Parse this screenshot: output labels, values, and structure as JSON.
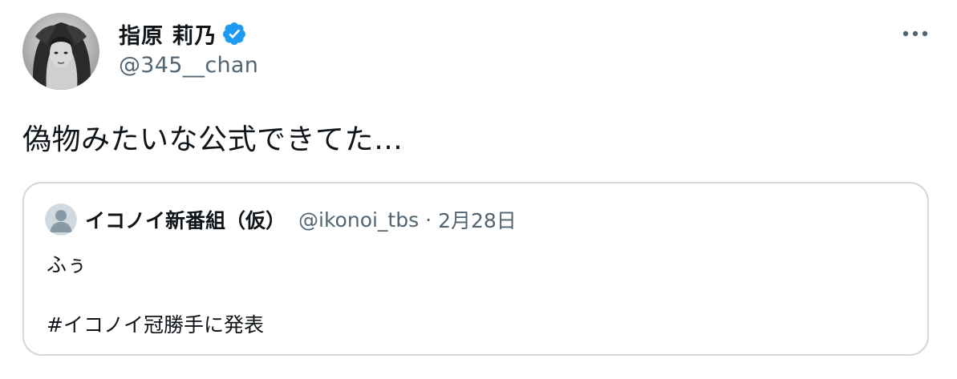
{
  "author": {
    "display_name": "指原 莉乃",
    "handle": "@345__chan",
    "verified": true,
    "avatar_icon": "user-avatar-photo",
    "verified_icon": "verified-badge-icon",
    "verified_color": "#1d9bf0"
  },
  "tweet": {
    "text": "偽物みたいな公式できてた…"
  },
  "more_icon": "more-dots-icon",
  "quote": {
    "display_name": "イコノイ新番組（仮）",
    "handle": "@ikonoi_tbs",
    "separator": "·",
    "date": "2月28日",
    "avatar_icon": "default-avatar-icon",
    "line1": "ふぅ",
    "line2": "#イコノイ冠勝手に発表"
  },
  "colors": {
    "text_primary": "#0f1419",
    "text_secondary": "#536471",
    "border": "#cfd9de",
    "accent": "#1d9bf0"
  }
}
